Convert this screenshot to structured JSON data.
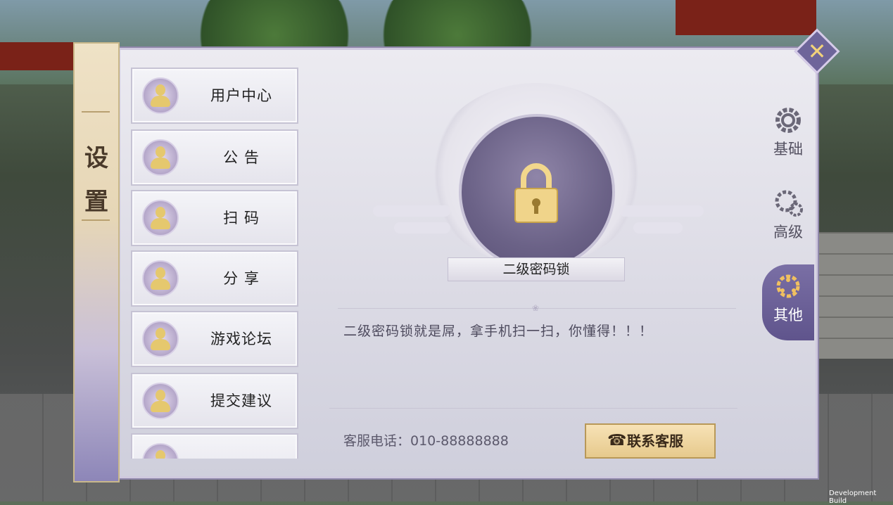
{
  "settings_panel": {
    "banner_title": "设\n置",
    "menu": [
      {
        "label": "用户中心"
      },
      {
        "label": "公 告"
      },
      {
        "label": "扫 码"
      },
      {
        "label": "分 享"
      },
      {
        "label": "游戏论坛"
      },
      {
        "label": "提交建议"
      },
      {
        "label": "..."
      }
    ],
    "tabs": [
      {
        "label": "基础",
        "icon": "gear-icon",
        "active": false
      },
      {
        "label": "高级",
        "icon": "gears-icon",
        "active": false
      },
      {
        "label": "其他",
        "icon": "network-icon",
        "active": true
      }
    ],
    "content": {
      "lock_title": "二级密码锁",
      "description": "二级密码锁就是屌，拿手机扫一扫，你懂得！！！",
      "phone_text": "客服电话：010-88888888",
      "contact_button": "联系客服"
    }
  },
  "overlay": {
    "dev_build": "Development Build"
  },
  "colors": {
    "accent": "#e5c86e",
    "tab_active": "#6a5f96",
    "button_gold": "#e6c98c"
  }
}
